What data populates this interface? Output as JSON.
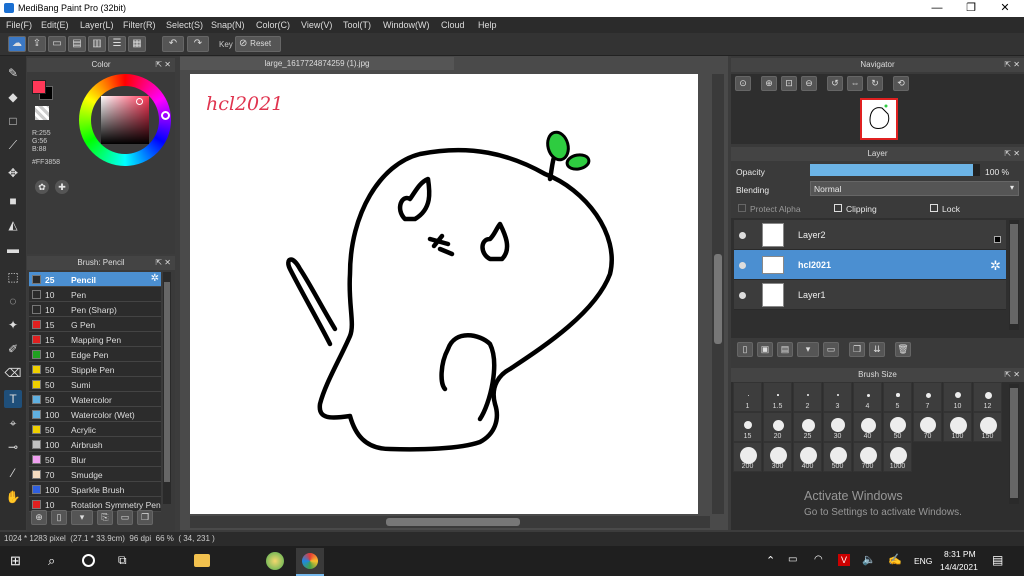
{
  "window": {
    "title": "MediBang Paint Pro (32bit)",
    "minimize": "—",
    "restore": "❐",
    "close": "✕"
  },
  "menu": [
    "File(F)",
    "Edit(E)",
    "Layer(L)",
    "Filter(R)",
    "Select(S)",
    "Snap(N)",
    "Color(C)",
    "View(V)",
    "Tool(T)",
    "Window(W)",
    "Cloud",
    "Help"
  ],
  "toolbar": {
    "key_label": "Key",
    "reset_label": "Reset"
  },
  "color_panel": {
    "title": "Color",
    "rgb": [
      "R:255",
      "G:56",
      "B:88"
    ],
    "hex": "#FF3858",
    "primary_color": "#FF3858"
  },
  "brush_panel": {
    "title": "Brush: Pencil",
    "items": [
      {
        "size": "25",
        "name": "Pencil",
        "color": "#2b2b2b"
      },
      {
        "size": "10",
        "name": "Pen",
        "color": "#2b2b2b"
      },
      {
        "size": "10",
        "name": "Pen (Sharp)",
        "color": "#2b2b2b"
      },
      {
        "size": "15",
        "name": "G Pen",
        "color": "#e02020"
      },
      {
        "size": "15",
        "name": "Mapping Pen",
        "color": "#e02020"
      },
      {
        "size": "10",
        "name": "Edge Pen",
        "color": "#20a020"
      },
      {
        "size": "50",
        "name": "Stipple Pen",
        "color": "#f0d000"
      },
      {
        "size": "50",
        "name": "Sumi",
        "color": "#f0d000"
      },
      {
        "size": "50",
        "name": "Watercolor",
        "color": "#60b0e0"
      },
      {
        "size": "100",
        "name": "Watercolor (Wet)",
        "color": "#60b0e0"
      },
      {
        "size": "50",
        "name": "Acrylic",
        "color": "#f0d000"
      },
      {
        "size": "100",
        "name": "Airbrush",
        "color": "#c0c0c0"
      },
      {
        "size": "50",
        "name": "Blur",
        "color": "#f0a0f0"
      },
      {
        "size": "70",
        "name": "Smudge",
        "color": "#f5dcc0"
      },
      {
        "size": "100",
        "name": "Sparkle Brush",
        "color": "#3060e0"
      },
      {
        "size": "10",
        "name": "Rotation Symmetry Pen",
        "color": "#e02020"
      }
    ]
  },
  "document": {
    "tab": "large_1617724874259 (1).jpg",
    "canvas_text": "hcl2021"
  },
  "navigator": {
    "title": "Navigator"
  },
  "layer_panel": {
    "title": "Layer",
    "opacity_label": "Opacity",
    "opacity_value": "100 %",
    "opacity_fraction": 1.0,
    "blending_label": "Blending",
    "blending_value": "Normal",
    "protect_alpha": "Protect Alpha",
    "clipping": "Clipping",
    "lock": "Lock",
    "layers": [
      {
        "name": "Layer2",
        "selected": false
      },
      {
        "name": "hcl2021",
        "selected": true
      },
      {
        "name": "Layer1",
        "selected": false
      }
    ]
  },
  "brush_size": {
    "title": "Brush Size",
    "sizes": [
      "1",
      "1.5",
      "2",
      "3",
      "4",
      "5",
      "7",
      "10",
      "12",
      "15",
      "20",
      "25",
      "30",
      "40",
      "50",
      "70",
      "100",
      "150",
      "200",
      "300",
      "400",
      "500",
      "700",
      "1000"
    ]
  },
  "status": {
    "text": "1024 * 1283 pixel  (27.1 * 33.9cm)  96 dpi  66 %  ( 34, 231 )"
  },
  "activation": {
    "line1": "Activate Windows",
    "line2": "Go to Settings to activate Windows."
  },
  "taskbar": {
    "lang": "ENG",
    "time": "8:31 PM",
    "date": "14/4/2021"
  }
}
